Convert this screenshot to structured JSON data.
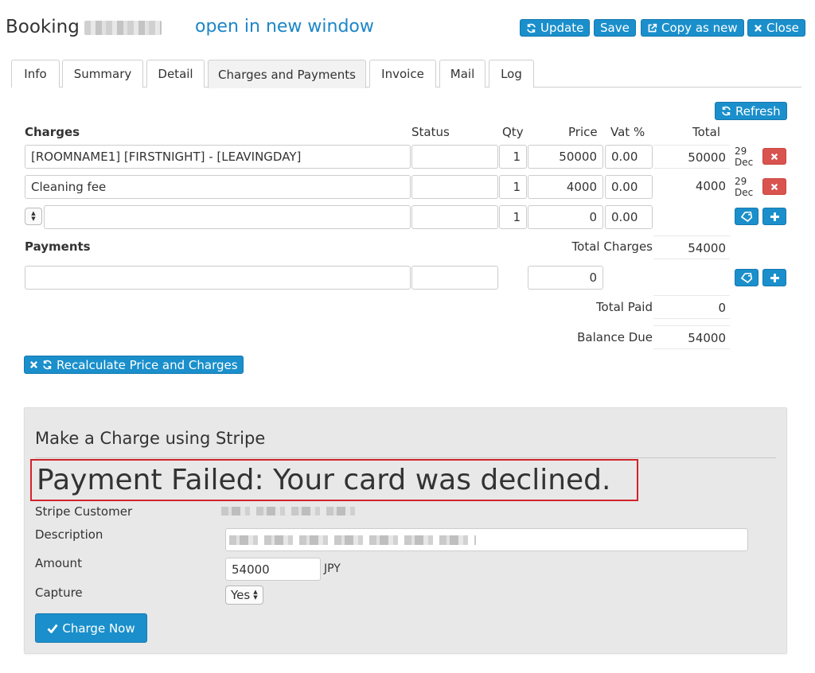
{
  "header": {
    "title": "Booking",
    "open_link": "open in new window",
    "buttons": {
      "update": "Update",
      "save": "Save",
      "copy": "Copy as new",
      "close": "Close"
    }
  },
  "tabs": [
    "Info",
    "Summary",
    "Detail",
    "Charges and Payments",
    "Invoice",
    "Mail",
    "Log"
  ],
  "active_tab": "Charges and Payments",
  "refresh_label": "Refresh",
  "charges": {
    "heading": "Charges",
    "columns": {
      "status": "Status",
      "qty": "Qty",
      "price": "Price",
      "vat": "Vat %",
      "total": "Total"
    },
    "rows": [
      {
        "description": "[ROOMNAME1] [FIRSTNIGHT] - [LEAVINGDAY]",
        "status": "",
        "qty": "1",
        "price": "50000",
        "vat": "0.00",
        "total": "50000",
        "date_day": "29",
        "date_month": "Dec"
      },
      {
        "description": "Cleaning fee",
        "status": "",
        "qty": "1",
        "price": "4000",
        "vat": "0.00",
        "total": "4000",
        "date_day": "29",
        "date_month": "Dec"
      }
    ],
    "new_row": {
      "description": "",
      "status": "",
      "qty": "1",
      "price": "0",
      "vat": "0.00"
    },
    "total_charges_label": "Total Charges",
    "total_charges": "54000"
  },
  "payments": {
    "heading": "Payments",
    "new_row": {
      "description": "",
      "status": "",
      "amount": "0"
    },
    "total_paid_label": "Total Paid",
    "total_paid": "0",
    "balance_due_label": "Balance Due",
    "balance_due": "54000"
  },
  "recalculate_label": "Recalculate Price and Charges",
  "stripe": {
    "title": "Make a Charge using Stripe",
    "error": "Payment Failed: Your card was declined.",
    "customer_label": "Stripe Customer",
    "description_label": "Description",
    "amount_label": "Amount",
    "amount_value": "54000",
    "currency": "JPY",
    "capture_label": "Capture",
    "capture_value": "Yes",
    "charge_button": "Charge Now"
  },
  "colors": {
    "accent": "#1a8fcb",
    "danger": "#d9534f",
    "error_border": "#d0232a",
    "link": "#1c86c7"
  }
}
